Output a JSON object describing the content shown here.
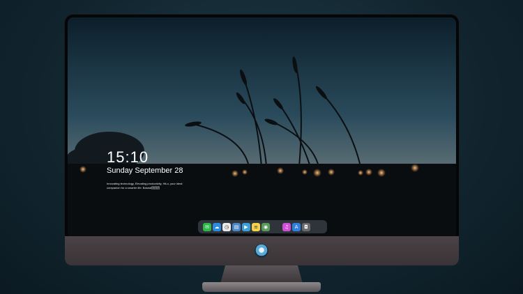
{
  "lockscreen": {
    "time": "15:10",
    "date": "Sunday September 28",
    "tagline": "Innovating technology, Elevating productivity, HiLo, your ideal companion for a smarter life. Baseal团团团"
  },
  "dock": {
    "apps": [
      {
        "name": "messages",
        "glyph": "✉",
        "color": "#2fb94b"
      },
      {
        "name": "weather",
        "glyph": "☁",
        "color": "#2a8be0"
      },
      {
        "name": "clock",
        "glyph": "◷",
        "color": "#eaeaea"
      },
      {
        "name": "finder",
        "glyph": "▤",
        "color": "#4a86c8"
      },
      {
        "name": "video",
        "glyph": "▶",
        "color": "#3aa0d8"
      },
      {
        "name": "notes",
        "glyph": "≡",
        "color": "#f4d24a"
      },
      {
        "name": "photos",
        "glyph": "◉",
        "color": "#5a9a5a"
      },
      {
        "name": "music",
        "glyph": "♫",
        "color": "#d04fd8"
      },
      {
        "name": "app-store",
        "glyph": "A",
        "color": "#2f7fe0"
      },
      {
        "name": "camera",
        "glyph": "◘",
        "color": "#6a6a6e"
      }
    ]
  }
}
